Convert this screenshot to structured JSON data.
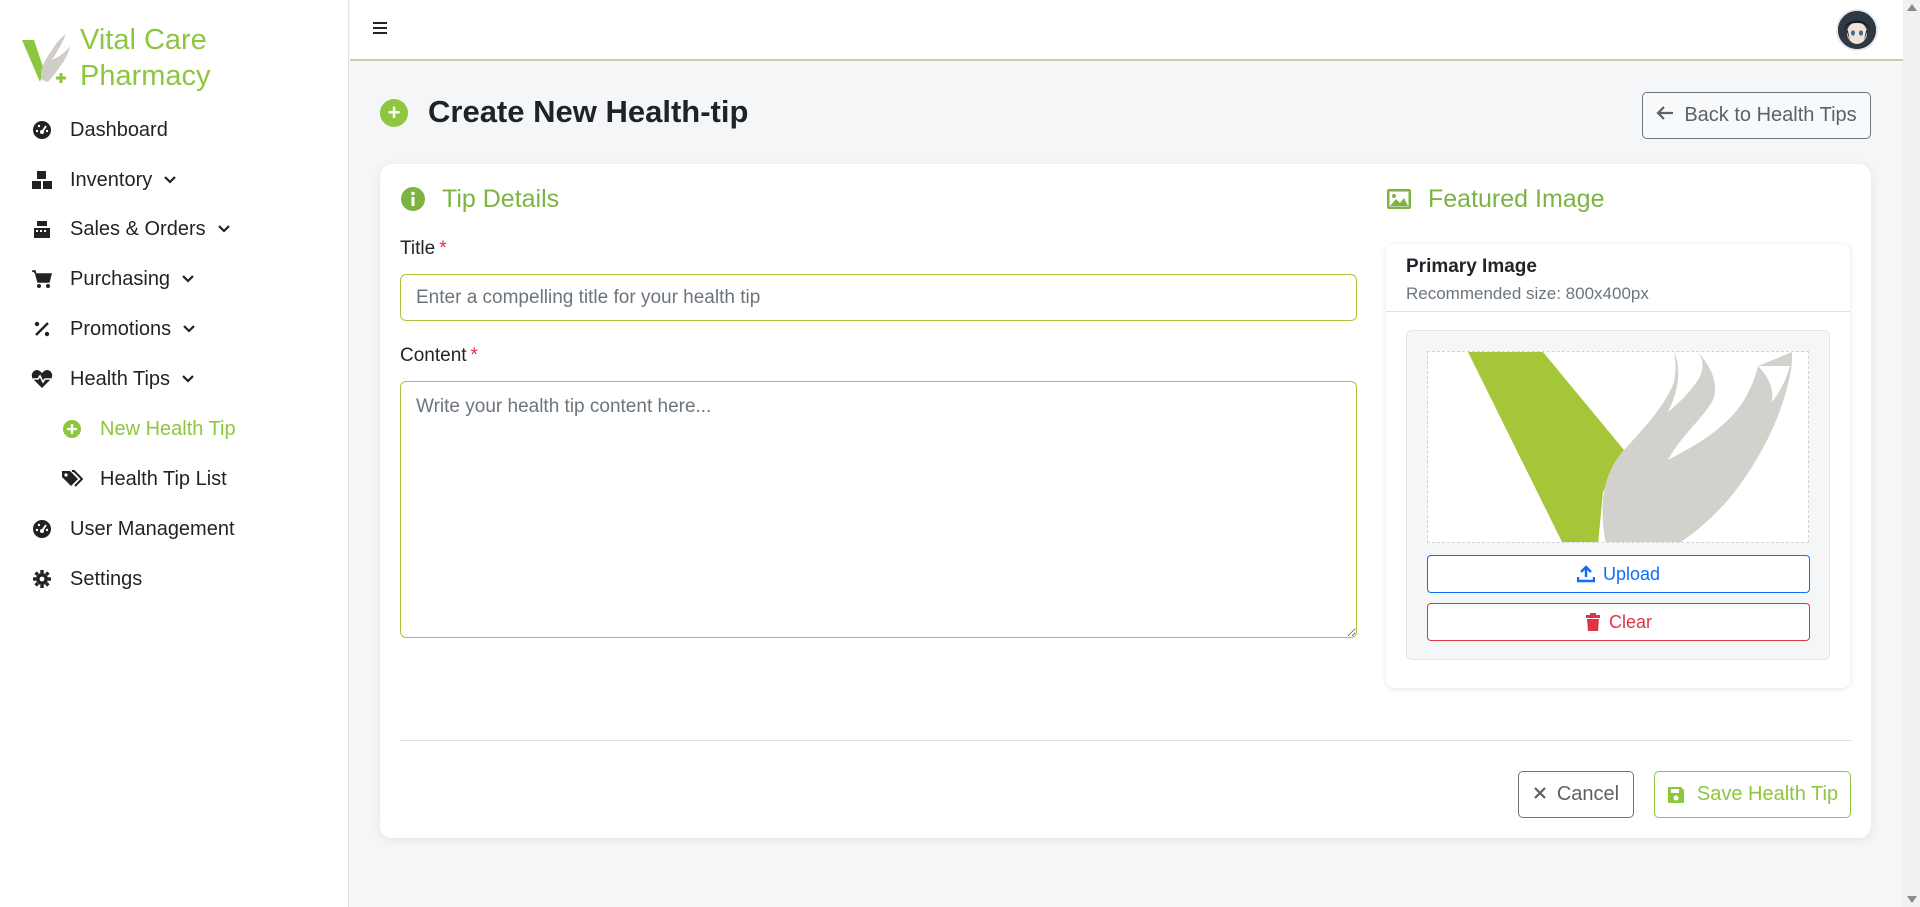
{
  "brand": {
    "name": "Vital Care Pharmacy",
    "accent": "#8dc63f"
  },
  "sidebar": {
    "items": [
      {
        "label": "Dashboard",
        "icon": "dashboard-gauge-icon"
      },
      {
        "label": "Inventory",
        "icon": "boxes-icon",
        "expandable": true
      },
      {
        "label": "Sales & Orders",
        "icon": "cash-register-icon",
        "expandable": true
      },
      {
        "label": "Purchasing",
        "icon": "cart-icon",
        "expandable": true
      },
      {
        "label": "Promotions",
        "icon": "percent-icon",
        "expandable": true
      },
      {
        "label": "Health Tips",
        "icon": "heart-pulse-icon",
        "expandable": true,
        "expanded": true
      },
      {
        "label": "New Health Tip",
        "icon": "plus-circle-icon",
        "sub": true,
        "active": true
      },
      {
        "label": "Health Tip List",
        "icon": "tags-icon",
        "sub": true
      },
      {
        "label": "User Management",
        "icon": "dashboard-gauge-icon"
      },
      {
        "label": "Settings",
        "icon": "gear-icon"
      }
    ]
  },
  "topbar": {
    "menu_icon": "hamburger-icon",
    "avatar": "user-avatar"
  },
  "page": {
    "title": "Create New Health-tip",
    "back_label": "Back to Health Tips"
  },
  "form": {
    "details_title": "Tip Details",
    "title_label": "Title",
    "required_mark": "*",
    "title_placeholder": "Enter a compelling title for your health tip",
    "title_value": "",
    "content_label": "Content",
    "content_placeholder": "Write your health tip content here...",
    "content_value": ""
  },
  "image": {
    "section_title": "Featured Image",
    "panel_title": "Primary Image",
    "panel_subtitle": "Recommended size: 800x400px",
    "upload_label": "Upload",
    "clear_label": "Clear"
  },
  "actions": {
    "cancel_label": "Cancel",
    "save_label": "Save Health Tip"
  },
  "colors": {
    "accent": "#8dc63f",
    "upload": "#0d6efd",
    "danger": "#dc3545",
    "muted": "#6c757d"
  }
}
